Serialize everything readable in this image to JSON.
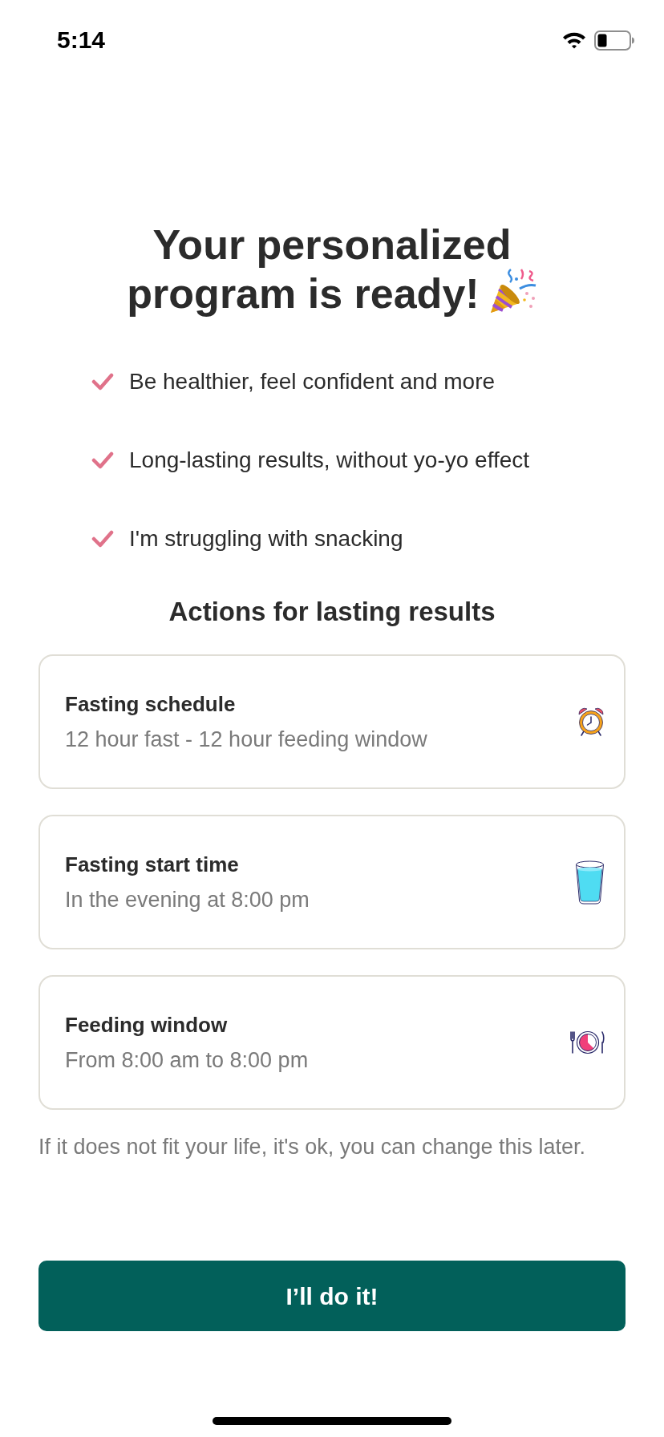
{
  "status_bar": {
    "time": "5:14"
  },
  "title": "Your personalized program is ready!",
  "benefits": [
    "Be healthier, feel confident and more",
    "Long-lasting results, without yo-yo effect",
    "I'm struggling with snacking"
  ],
  "actions_title": "Actions for lasting results",
  "actions": [
    {
      "kind": "alarm",
      "title": "Fasting schedule",
      "detail": "12 hour fast - 12 hour feeding window"
    },
    {
      "kind": "drink",
      "title": "Fasting start time",
      "detail": "In the evening at 8:00 pm"
    },
    {
      "kind": "meal",
      "title": "Feeding window",
      "detail": "From 8:00 am to 8:00 pm"
    }
  ],
  "note": "If it does not fit your life, it's ok, you can change this later.",
  "primary_button": "I’ll do it!"
}
